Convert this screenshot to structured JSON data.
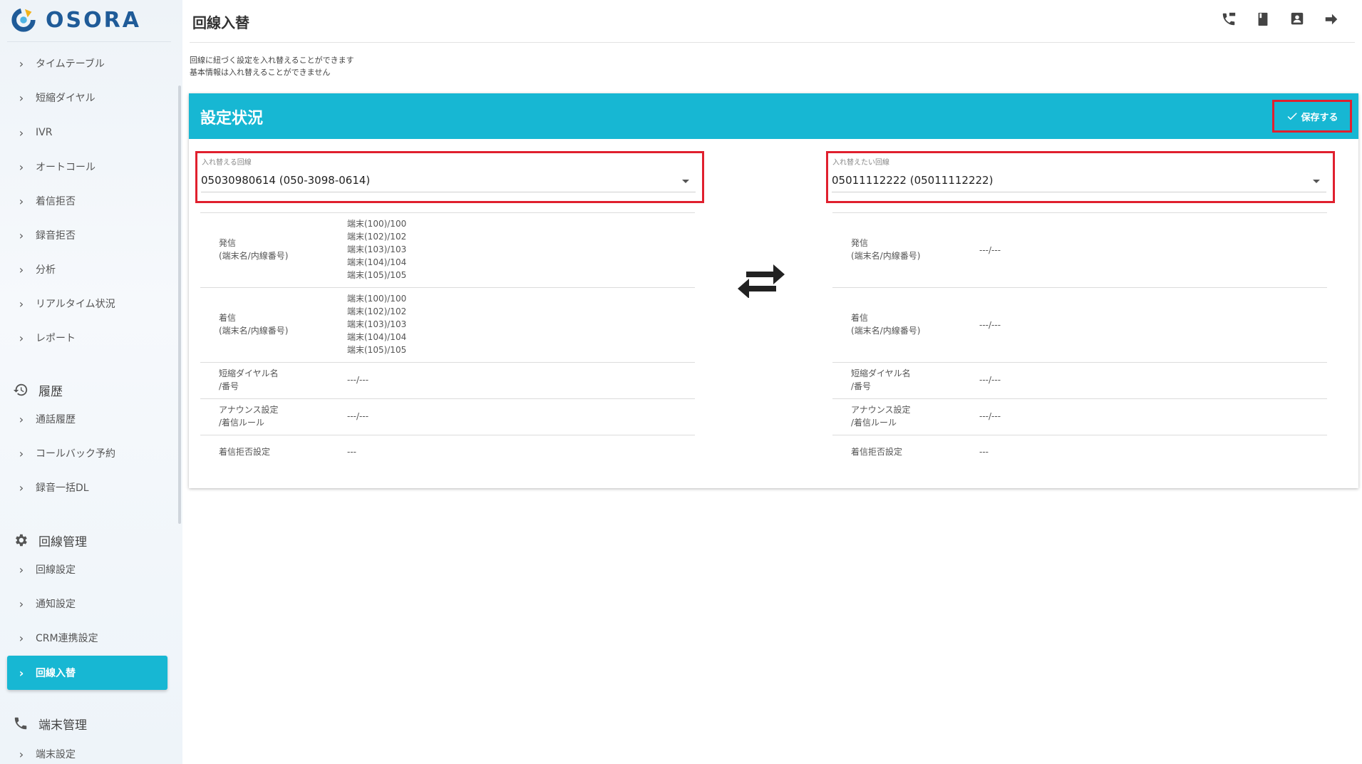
{
  "sidebar": {
    "logo_text": "OSORA",
    "menu_top": [
      {
        "label": "タイムテーブル"
      },
      {
        "label": "短縮ダイヤル"
      },
      {
        "label": "IVR"
      },
      {
        "label": "オートコール"
      },
      {
        "label": "着信拒否"
      },
      {
        "label": "録音拒否"
      },
      {
        "label": "分析"
      },
      {
        "label": "リアルタイム状況"
      },
      {
        "label": "レポート"
      }
    ],
    "history_group": {
      "label": "履歴",
      "items": [
        {
          "label": "通話履歴"
        },
        {
          "label": "コールバック予約"
        },
        {
          "label": "録音一括DL"
        }
      ]
    },
    "line_group": {
      "label": "回線管理",
      "items": [
        {
          "label": "回線設定"
        },
        {
          "label": "通知設定"
        },
        {
          "label": "CRM連携設定"
        },
        {
          "label": "回線入替",
          "active": true
        }
      ]
    },
    "terminal_group": {
      "label": "端末管理",
      "items": [
        {
          "label": "端末設定"
        }
      ]
    }
  },
  "header": {
    "title": "回線入替",
    "icons": [
      "sip-phone-icon",
      "book-icon",
      "contact-icon",
      "logout-arrow-icon"
    ]
  },
  "description": {
    "line1": "回線に紐づく設定を入れ替えることができます",
    "line2": "基本情報は入れ替えることができません"
  },
  "card": {
    "title": "設定状況",
    "save_label": "保存する",
    "left": {
      "label": "入れ替える回線",
      "value": "05030980614 (050-3098-0614)",
      "rows": {
        "outgoing_label_1": "発信",
        "outgoing_label_2": "(端末名/内線番号)",
        "outgoing_values": [
          "端末(100)/100",
          "端末(102)/102",
          "端末(103)/103",
          "端末(104)/104",
          "端末(105)/105"
        ],
        "incoming_label_1": "着信",
        "incoming_label_2": "(端末名/内線番号)",
        "incoming_values": [
          "端末(100)/100",
          "端末(102)/102",
          "端末(103)/103",
          "端末(104)/104",
          "端末(105)/105"
        ],
        "speed_label_1": "短縮ダイヤル名",
        "speed_label_2": "/番号",
        "speed_value": "---/---",
        "announce_label_1": "アナウンス設定",
        "announce_label_2": "/着信ルール",
        "announce_value": "---/---",
        "reject_label": "着信拒否設定",
        "reject_value": "---"
      }
    },
    "right": {
      "label": "入れ替えたい回線",
      "value": "05011112222 (05011112222)",
      "rows": {
        "outgoing_label_1": "発信",
        "outgoing_label_2": "(端末名/内線番号)",
        "outgoing_value": "---/---",
        "incoming_label_1": "着信",
        "incoming_label_2": "(端末名/内線番号)",
        "incoming_value": "---/---",
        "speed_label_1": "短縮ダイヤル名",
        "speed_label_2": "/番号",
        "speed_value": "---/---",
        "announce_label_1": "アナウンス設定",
        "announce_label_2": "/着信ルール",
        "announce_value": "---/---",
        "reject_label": "着信拒否設定",
        "reject_value": "---"
      }
    }
  },
  "colors": {
    "accent": "#17b7d3",
    "highlight_border": "#e0202e",
    "logo": "#1f5b98"
  }
}
